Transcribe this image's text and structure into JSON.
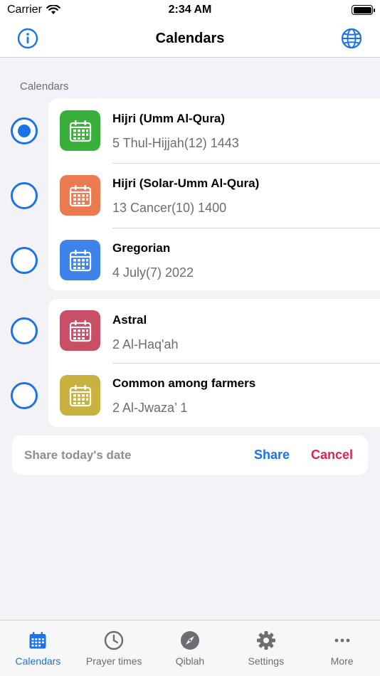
{
  "status_bar": {
    "carrier": "Carrier",
    "time": "2:34 AM"
  },
  "nav": {
    "title": "Calendars"
  },
  "section": {
    "header": "Calendars"
  },
  "calendars": [
    {
      "title": "Hijri (Umm Al-Qura)",
      "date": "5 Thul-Hijjah(12) 1443",
      "color": "#3aae3a",
      "selected": true
    },
    {
      "title": "Hijri (Solar-Umm Al-Qura)",
      "date": "13 Cancer(10) 1400",
      "color": "#ec7a50",
      "selected": false
    },
    {
      "title": "Gregorian",
      "date": "4 July(7) 2022",
      "color": "#3d83e9",
      "selected": false
    },
    {
      "title": "Astral",
      "date": "2 Al-Haq'ah",
      "color": "#c94f66",
      "selected": false
    },
    {
      "title": "Common among farmers",
      "date": "2 Al-Jwaza’ 1",
      "color": "#c9b13f",
      "selected": false
    }
  ],
  "share": {
    "label": "Share today's date",
    "share_label": "Share",
    "cancel_label": "Cancel"
  },
  "tabs": [
    {
      "label": "Calendars",
      "icon": "calendar-icon",
      "active": true
    },
    {
      "label": "Prayer times",
      "icon": "clock-icon",
      "active": false
    },
    {
      "label": "Qiblah",
      "icon": "compass-icon",
      "active": false
    },
    {
      "label": "Settings",
      "icon": "gear-icon",
      "active": false
    },
    {
      "label": "More",
      "icon": "more-icon",
      "active": false
    }
  ],
  "colors": {
    "accent": "#1a73e8",
    "cancel": "#e0244e"
  }
}
